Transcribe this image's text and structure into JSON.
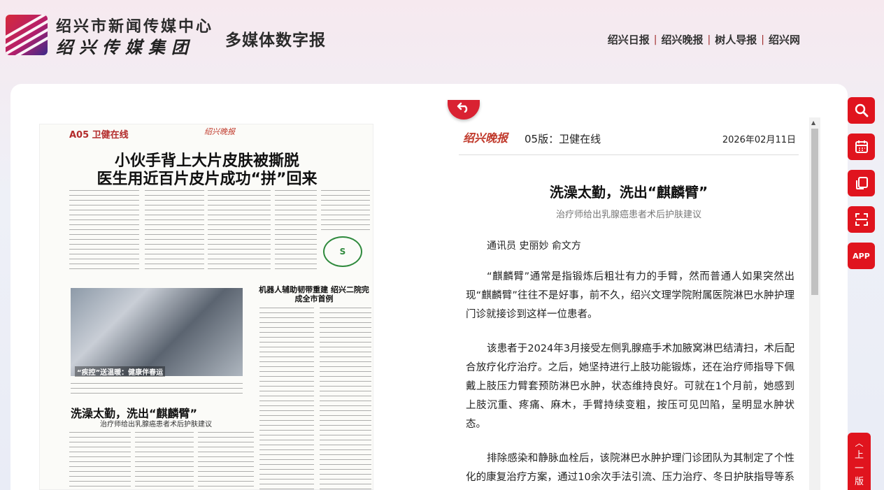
{
  "header": {
    "org_name": "绍兴市新闻传媒中心",
    "group_name": "绍兴传媒集团",
    "site_title": "多媒体数字报",
    "nav": [
      "绍兴日报",
      "绍兴晚报",
      "树人导报",
      "绍兴网"
    ],
    "nav_separator": "|"
  },
  "page_preview": {
    "page_label": "A05 卫健在线",
    "brand": "绍兴晚报",
    "headline_line1": "小伙手背上大片皮肤被撕脱",
    "headline_line2": "医生用近百片皮片成功“拼”回来",
    "photo_caption": "“疾控”送温暖：健康伴春运",
    "robot_headline": "机器人辅助韧带重建 绍兴二院完成全市首例",
    "wash_headline": "洗澡太勤，洗出“麒麟臂”",
    "wash_subheadline": "治疗师给出乳腺癌患者术后护肤建议"
  },
  "back_button": {
    "icon": "back-arrow-icon"
  },
  "article": {
    "brand": "绍兴晚报",
    "page": "05版：卫健在线",
    "date": "2026年02月11日",
    "title": "洗澡太勤，洗出“麒麟臂”",
    "subtitle": "治疗师给出乳腺癌患者术后护肤建议",
    "byline": "通讯员 史丽妙 俞文方",
    "paragraphs": [
      "“麒麟臂”通常是指锻炼后粗壮有力的手臂，然而普通人如果突然出现“麒麟臂”往往不是好事，前不久，绍兴文理学院附属医院淋巴水肿护理门诊就接诊到这样一位患者。",
      "该患者于2024年3月接受左侧乳腺癌手术加腋窝淋巴结清扫，术后配合放疗化疗治疗。之后，她坚持进行上肢功能锻炼，还在治疗师指导下佩戴上肢压力臂套预防淋巴水肿，状态维持良好。可就在1个月前，她感到上肢沉重、疼痛、麻木，手臂持续变粗，按压可见凹陷，呈明显水肿状态。",
      "排除感染和静脉血栓后，该院淋巴水肿护理门诊团队为其制定了个性化的康复治疗方案，通过10余次手法引流、压力治疗、冬日护肤指导等系统干预，目前患者手臂水肿消退，疼痛等症状消失。"
    ]
  },
  "side_tools": {
    "search": "search-icon",
    "calendar": "calendar-icon",
    "copy": "copy-icon",
    "scan": "scan-icon",
    "app": "APP"
  },
  "prev_page": {
    "label": "上一版"
  },
  "colors": {
    "accent": "#e0141e",
    "brand_red": "#c0392b"
  }
}
